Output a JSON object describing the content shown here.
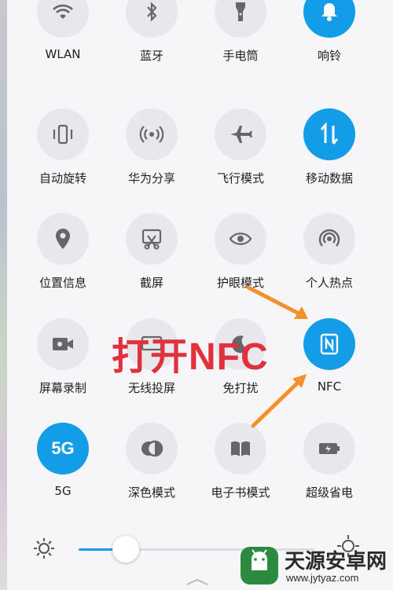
{
  "tiles": [
    {
      "label": "WLAN",
      "icon": "wifi-icon",
      "on": false
    },
    {
      "label": "蓝牙",
      "icon": "bluetooth-icon",
      "on": false
    },
    {
      "label": "手电筒",
      "icon": "flashlight-icon",
      "on": false
    },
    {
      "label": "响铃",
      "icon": "bell-icon",
      "on": true
    },
    {
      "label": "自动旋转",
      "icon": "auto-rotate-icon",
      "on": false
    },
    {
      "label": "华为分享",
      "icon": "huawei-share-icon",
      "on": false
    },
    {
      "label": "飞行模式",
      "icon": "airplane-icon",
      "on": false
    },
    {
      "label": "移动数据",
      "icon": "mobile-data-icon",
      "on": true
    },
    {
      "label": "位置信息",
      "icon": "location-icon",
      "on": false
    },
    {
      "label": "截屏",
      "icon": "screenshot-icon",
      "on": false
    },
    {
      "label": "护眼模式",
      "icon": "eye-icon",
      "on": false
    },
    {
      "label": "个人热点",
      "icon": "hotspot-icon",
      "on": false
    },
    {
      "label": "屏幕录制",
      "icon": "screen-record-icon",
      "on": false
    },
    {
      "label": "无线投屏",
      "icon": "wireless-projection-icon",
      "on": false
    },
    {
      "label": "免打扰",
      "icon": "do-not-disturb-icon",
      "on": false
    },
    {
      "label": "NFC",
      "icon": "nfc-icon",
      "on": true
    },
    {
      "label": "5G",
      "icon": "5g-icon",
      "icon_text": "5G",
      "on": true
    },
    {
      "label": "深色模式",
      "icon": "dark-mode-icon",
      "on": false
    },
    {
      "label": "电子书模式",
      "icon": "ebook-icon",
      "on": false
    },
    {
      "label": "超级省电",
      "icon": "battery-saver-icon",
      "on": false
    }
  ],
  "annotation": {
    "text": "打开NFC",
    "color": "#e0313c",
    "arrow_color": "#f5902b"
  },
  "brightness": {
    "level": 0.2
  },
  "watermark": {
    "name": "天源安卓网",
    "url": "www.jytyaz.com"
  },
  "colors": {
    "accent": "#139de8",
    "tile_off": "#e8e8ec"
  }
}
